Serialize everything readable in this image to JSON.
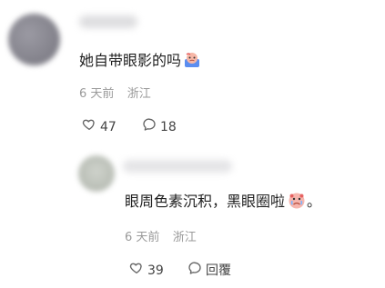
{
  "comments": [
    {
      "text": "她自带眼影的吗",
      "emoji_icon": "crying-face-emoji",
      "time": "6 天前",
      "location": "浙江",
      "likes": "47",
      "replies": "18"
    },
    {
      "text_before": "眼周色素沉积，黑眼圈啦",
      "text_after": "。",
      "emoji_icon": "crying-face-emoji",
      "time": "6 天前",
      "location": "浙江",
      "likes": "39",
      "reply_label": "回覆"
    }
  ],
  "colors": {
    "text": "#1f1f1f",
    "meta": "#9a9a9a",
    "icon": "#666666"
  }
}
